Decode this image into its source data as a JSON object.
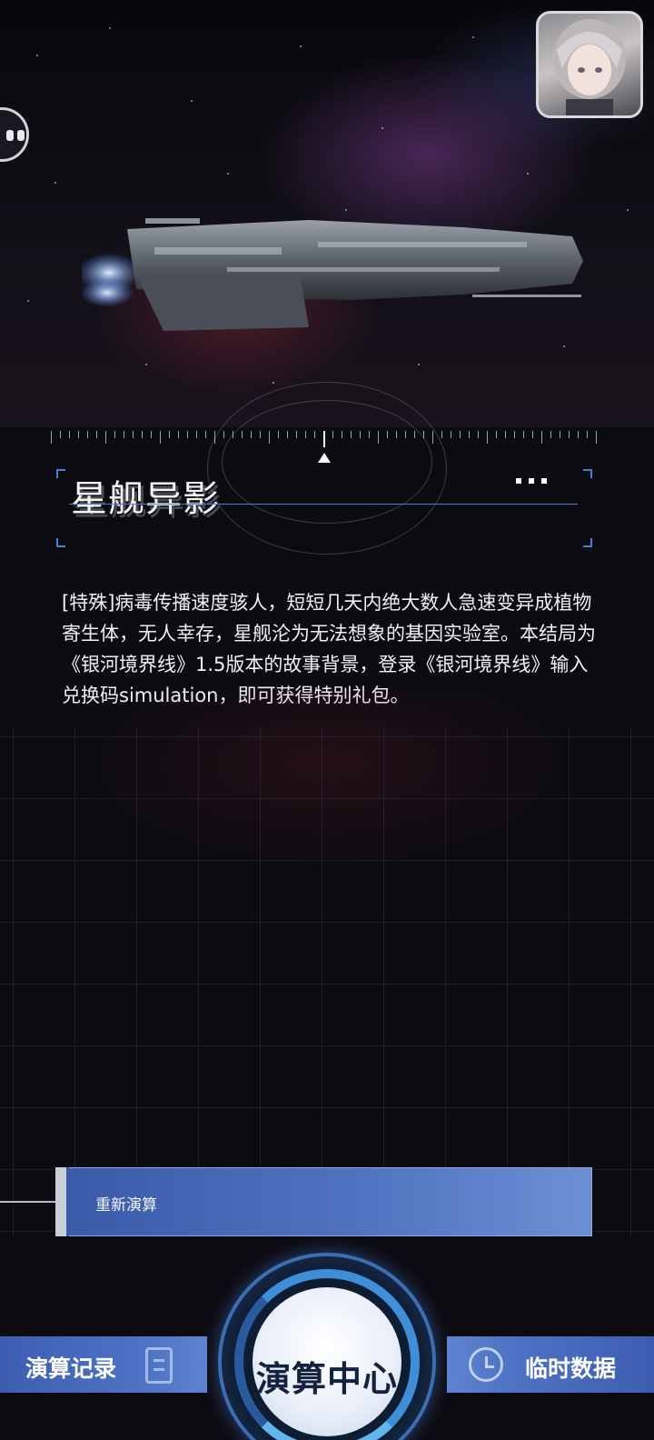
{
  "header": {
    "avatar_icon": "character-avatar-icon",
    "chat_icon": "chat-bubble-icon"
  },
  "ending": {
    "title": "星舰异影",
    "more_icon": "more-dots-icon",
    "description": "[特殊]病毒传播速度骇人，短短几天内绝大数人急速变异成植物寄生体，无人幸存，星舰沦为无法想象的基因实验室。本结局为《银河境界线》1.5版本的故事背景，登录《银河境界线》输入兑换码simulation，即可获得特别礼包。"
  },
  "actions": {
    "recalc_label": "重新演算"
  },
  "bottom_nav": {
    "left_label": "演算记录",
    "left_icon": "document-icon",
    "center_label": "演算中心",
    "right_label": "临时数据",
    "right_icon": "clock-icon"
  },
  "colors": {
    "accent_blue": "#4f73c4",
    "hub_ring": "#3f8fd8",
    "title_line": "#4f7fc8"
  }
}
